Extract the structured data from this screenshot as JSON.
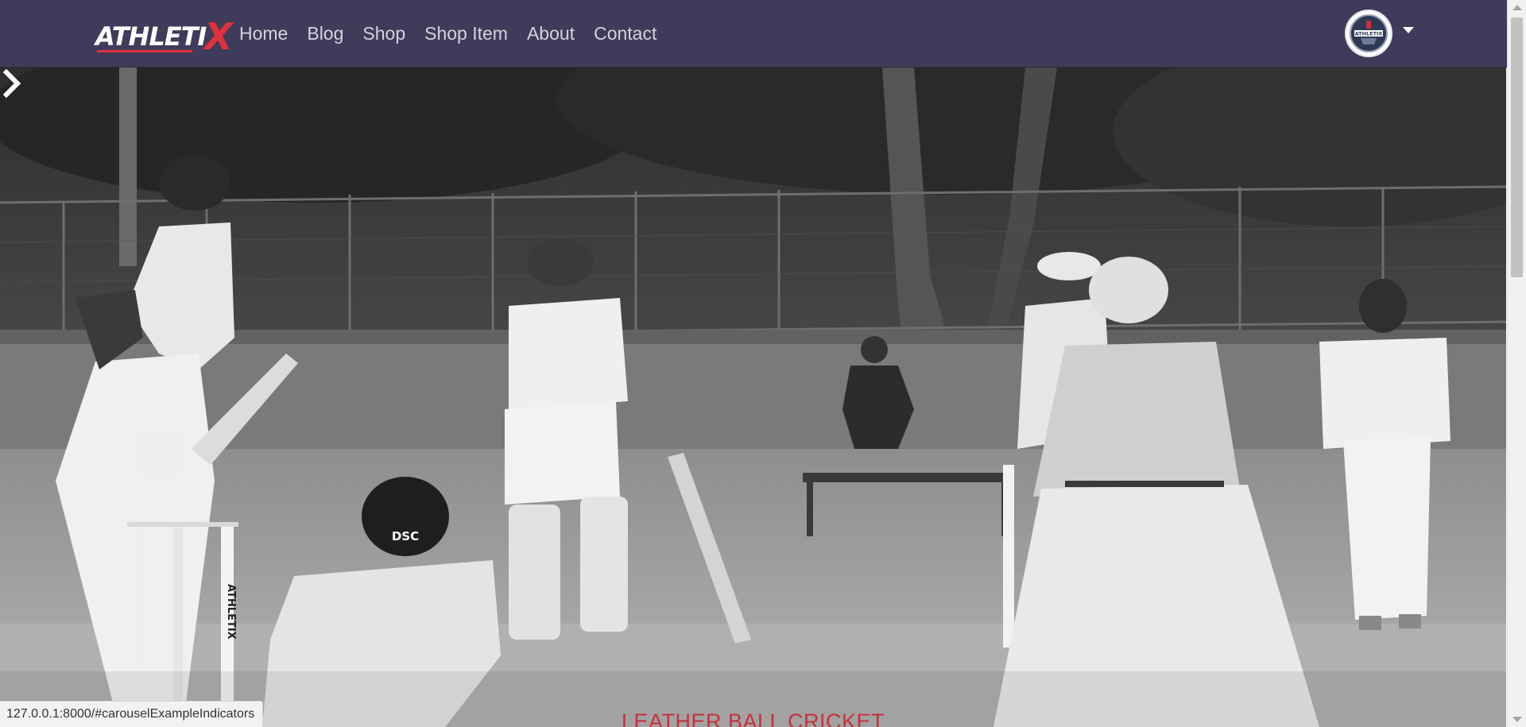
{
  "navbar": {
    "brand_text": "ATHLETI",
    "brand_accent": "X",
    "links": [
      "Home",
      "Blog",
      "Shop",
      "Shop Item",
      "About",
      "Contact"
    ],
    "avatar_icon": "athletix-badge-avatar",
    "avatar_badge_text": "ATHLETIX",
    "dropdown_icon": "caret-down-icon"
  },
  "carousel": {
    "image": "black-and-white photo of youth cricket match",
    "caption": "LEATHER BALL CRICKET",
    "wicketkeeper_helmet_text": "DSC",
    "stump_text": "ATHLETIX",
    "next_control_icon": "chevron-right-icon"
  },
  "status_bar": {
    "url": "127.0.0.1:8000/#carouselExampleIndicators"
  },
  "colors": {
    "navbar_bg": "#3f3b5a",
    "brand_accent": "#e0323c",
    "nav_link": "#d4d3de",
    "caption": "#c8303c"
  }
}
